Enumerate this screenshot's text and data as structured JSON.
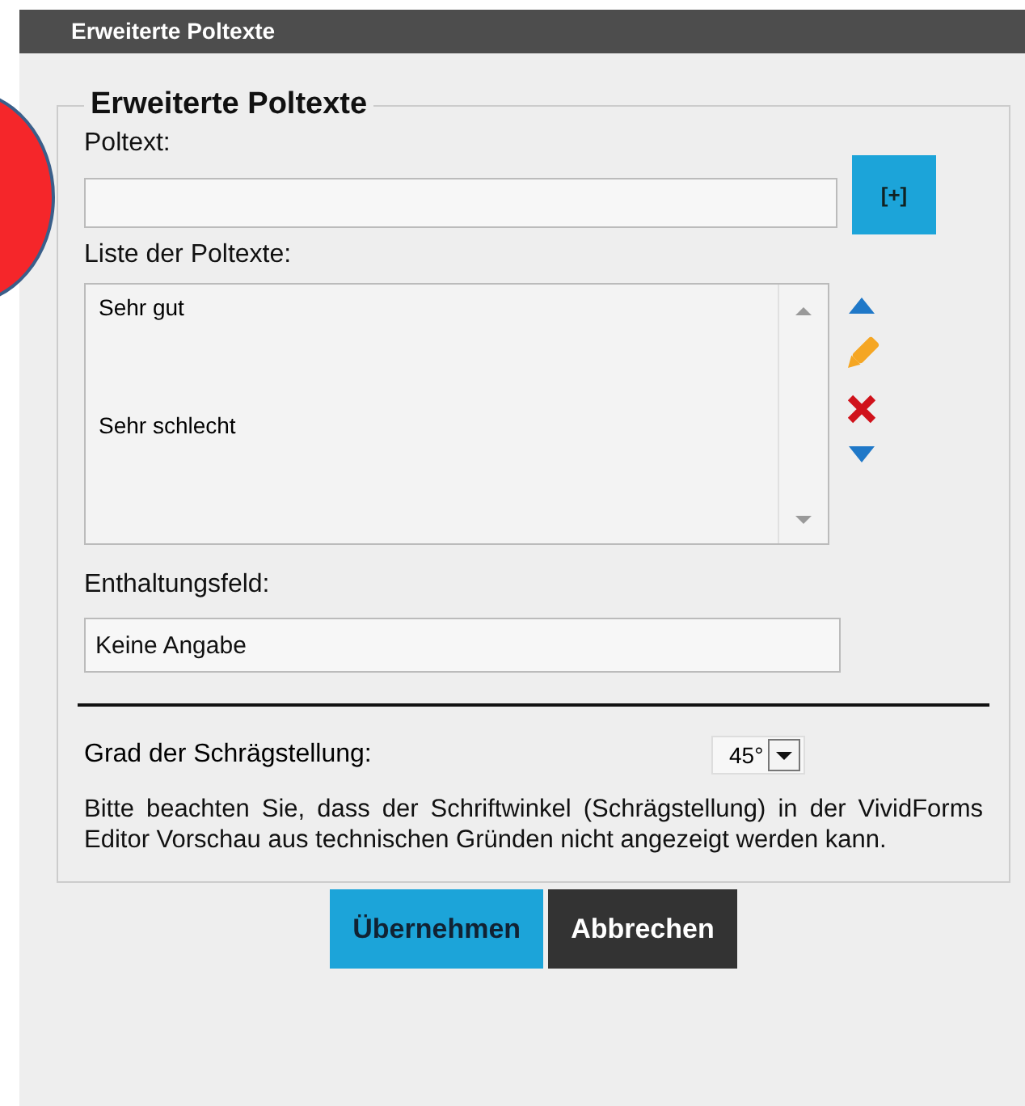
{
  "window": {
    "title": "Erweiterte Poltexte"
  },
  "section": {
    "legend": "Erweiterte Poltexte"
  },
  "poltext": {
    "label": "Poltext:",
    "add_button": "[+]"
  },
  "list": {
    "label": "Liste der Poltexte:",
    "items": [
      {
        "text": "Sehr gut"
      },
      {
        "text": "Sehr schlecht"
      }
    ]
  },
  "abstention": {
    "label": "Enthaltungsfeld:",
    "value": "Keine Angabe"
  },
  "slant": {
    "label": "Grad der Schrägstellung:",
    "value": "45°"
  },
  "note": "Bitte beachten Sie, dass der Schriftwinkel (Schrägstellung) in der VividForms Editor Vorschau aus technischen Gründen nicht angezeigt werden kann.",
  "buttons": [
    {
      "label": "Übernehmen",
      "kind": "primary"
    },
    {
      "label": "Abbrechen",
      "kind": "secondary"
    }
  ]
}
